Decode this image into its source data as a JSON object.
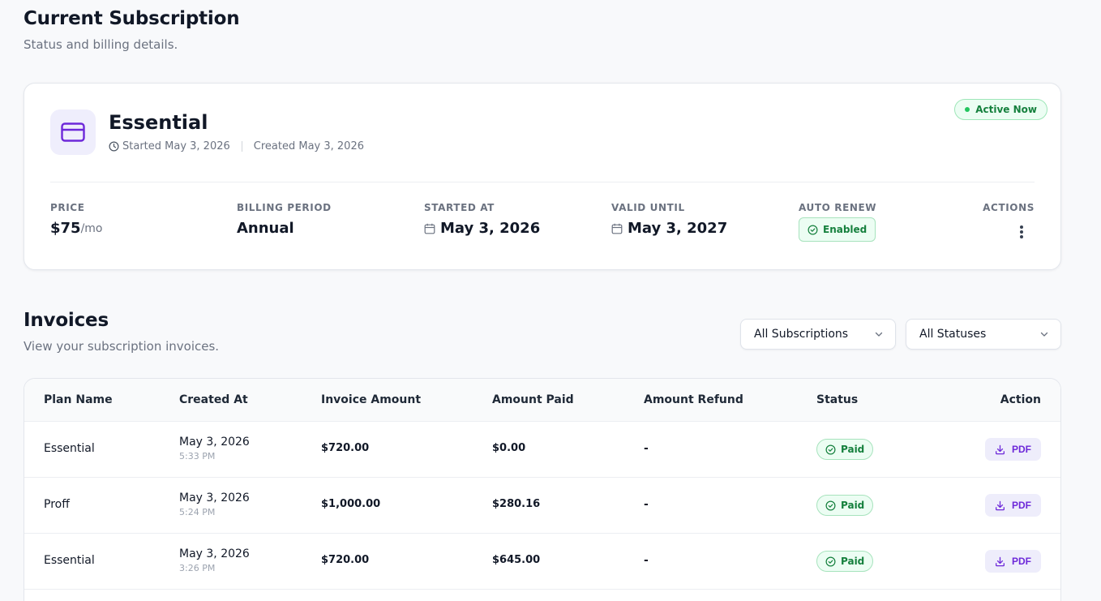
{
  "subscription_section": {
    "title": "Current Subscription",
    "subtitle": "Status and billing details."
  },
  "current_plan": {
    "name": "Essential",
    "started": "Started May 3, 2026",
    "created": "Created May 3, 2026",
    "status_badge": "Active Now",
    "price_label": "PRICE",
    "price_value": "$75",
    "price_unit": "/mo",
    "billing_period_label": "BILLING PERIOD",
    "billing_period_value": "Annual",
    "started_at_label": "STARTED AT",
    "started_at_value": "May 3, 2026",
    "valid_until_label": "VALID UNTIL",
    "valid_until_value": "May 3, 2027",
    "auto_renew_label": "AUTO RENEW",
    "auto_renew_value": "Enabled",
    "actions_label": "ACTIONS"
  },
  "invoices_section": {
    "title": "Invoices",
    "subtitle": "View your subscription invoices.",
    "subscription_filter": "All Subscriptions",
    "status_filter": "All Statuses"
  },
  "table": {
    "headers": {
      "plan_name": "Plan Name",
      "created_at": "Created At",
      "invoice_amount": "Invoice Amount",
      "amount_paid": "Amount Paid",
      "amount_refund": "Amount Refund",
      "status": "Status",
      "action": "Action"
    },
    "rows": [
      {
        "plan": "Essential",
        "date": "May 3, 2026",
        "time": "5:33 PM",
        "invoice_amount": "$720.00",
        "amount_paid": "$0.00",
        "refund": "-",
        "status": "Paid",
        "action": "PDF"
      },
      {
        "plan": "Proff",
        "date": "May 3, 2026",
        "time": "5:24 PM",
        "invoice_amount": "$1,000.00",
        "amount_paid": "$280.16",
        "refund": "-",
        "status": "Paid",
        "action": "PDF"
      },
      {
        "plan": "Essential",
        "date": "May 3, 2026",
        "time": "3:26 PM",
        "invoice_amount": "$720.00",
        "amount_paid": "$645.00",
        "refund": "-",
        "status": "Paid",
        "action": "PDF"
      }
    ]
  },
  "colors": {
    "accent": "#6d28d9",
    "success": "#15803d",
    "success_bg": "#ecfdf3"
  },
  "icons": {
    "plan": "credit-card-icon",
    "started": "clock-icon",
    "date": "calendar-icon",
    "enabled": "check-circle-icon",
    "actions": "kebab-menu-icon",
    "select": "chevron-down-icon",
    "download": "download-icon"
  }
}
